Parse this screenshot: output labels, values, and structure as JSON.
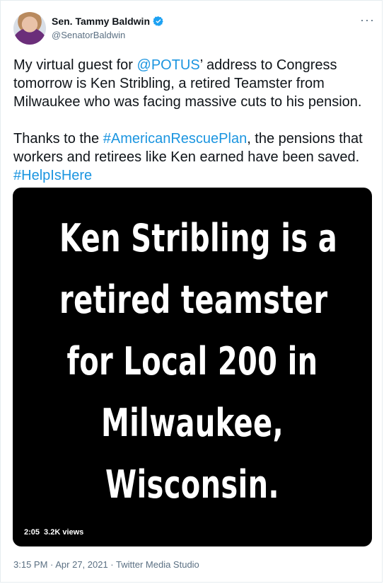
{
  "tweet": {
    "display_name": "Sen. Tammy Baldwin",
    "handle": "@SenatorBaldwin",
    "more_label": "···",
    "text": {
      "p1_before": "My virtual guest for ",
      "p1_mention": "@POTUS",
      "p1_after": "’ address to Congress tomorrow is Ken Stribling, a retired Teamster from Milwaukee who was facing massive cuts to his pension.",
      "p2_before": "Thanks to the ",
      "p2_hashtag1": "#AmericanRescuePlan",
      "p2_after": ", the pensions that workers and retirees like Ken earned have been saved. ",
      "p2_hashtag2": "#HelpIsHere"
    },
    "media": {
      "lines": [
        "Ken Stribling is a",
        "retired teamster",
        "for Local 200 in",
        "Milwaukee,",
        "Wisconsin."
      ],
      "duration": "2:05",
      "views": "3.2K views"
    },
    "timestamp": "3:15 PM · Apr 27, 2021 · Twitter Media Studio"
  },
  "colors": {
    "link": "#1b95e0",
    "verified": "#1da1f2",
    "secondary_text": "#5b7083"
  }
}
